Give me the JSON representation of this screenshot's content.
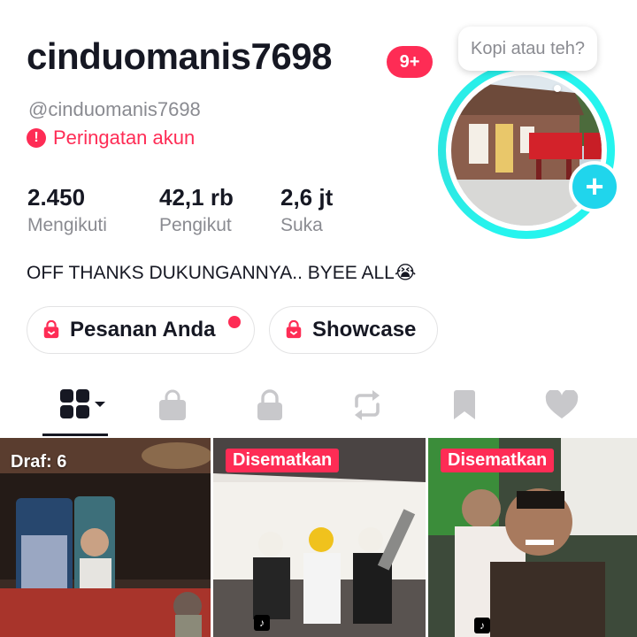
{
  "profile": {
    "username": "cinduomanis7698",
    "notification_badge": "9+",
    "handle": "@cinduomanis7698",
    "warning_text": "Peringatan akun",
    "warning_icon": "!",
    "bubble_text": "Kopi atau teh?",
    "bio": "OFF THANKS DUKUNGANNYA.. BYEE ALL😭"
  },
  "stats": [
    {
      "value": "2.450",
      "label": "Mengikuti"
    },
    {
      "value": "42,1 rb",
      "label": "Pengikut"
    },
    {
      "value": "2,6 jt",
      "label": "Suka"
    }
  ],
  "buttons": {
    "orders_label": "Pesanan Anda",
    "showcase_label": "Showcase"
  },
  "tabs": [
    {
      "icon": "grid-icon",
      "active": true
    },
    {
      "icon": "shopping-bag-icon",
      "active": false
    },
    {
      "icon": "lock-icon",
      "active": false
    },
    {
      "icon": "repost-icon",
      "active": false
    },
    {
      "icon": "bookmark-icon",
      "active": false
    },
    {
      "icon": "heart-icon",
      "active": false
    }
  ],
  "videos": [
    {
      "label": "Draf: 6"
    },
    {
      "label": "Disematkan"
    },
    {
      "label": "Disematkan"
    }
  ],
  "colors": {
    "accent": "#fe2c55",
    "ring": "#25f4ee",
    "add_button": "#20d5ec",
    "secondary_text": "#8a8b91"
  }
}
